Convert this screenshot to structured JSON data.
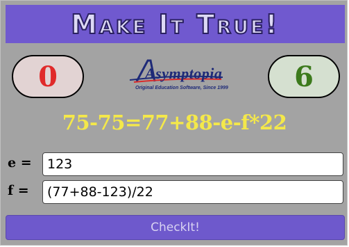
{
  "banner": {
    "title": "Make It True!"
  },
  "scores": {
    "left": "0",
    "right": "6"
  },
  "logo": {
    "name": "Asymptopia",
    "tagline": "Original Education Software, Since 1999"
  },
  "equation": "75-75=77+88-e-f*22",
  "fields": {
    "e": {
      "label": "e =",
      "value": "123"
    },
    "f": {
      "label": "f =",
      "value": "(77+88-123)/22"
    }
  },
  "button": {
    "label": "CheckIt!"
  },
  "colors": {
    "banner": "#7059cf",
    "background": "#a3a3a3",
    "equation": "#f4e84a",
    "left_score": "#e02a2a",
    "right_score": "#3c7a1c"
  }
}
